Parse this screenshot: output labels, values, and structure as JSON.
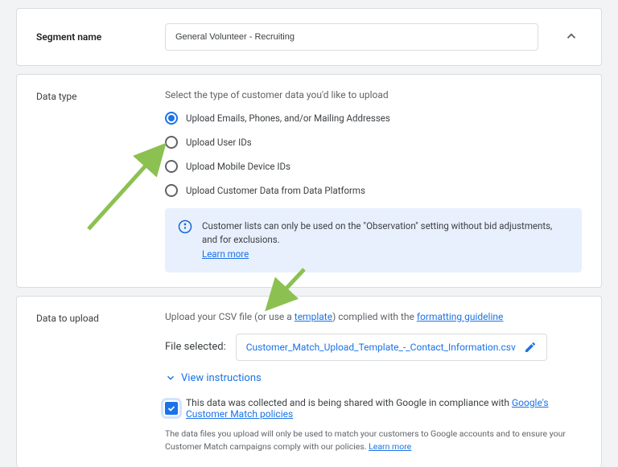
{
  "segment": {
    "label": "Segment name",
    "value": "General Volunteer - Recruiting"
  },
  "datatype": {
    "label": "Data type",
    "desc": "Select the type of customer data you'd like to upload",
    "options": [
      {
        "label": "Upload Emails, Phones, and/or Mailing Addresses",
        "selected": true
      },
      {
        "label": "Upload User IDs",
        "selected": false
      },
      {
        "label": "Upload Mobile Device IDs",
        "selected": false
      },
      {
        "label": "Upload Customer Data from Data Platforms",
        "selected": false
      }
    ],
    "info_text": "Customer lists can only be used on the \"Observation\" setting without bid adjustments, and for exclusions. ",
    "info_link": "Learn more"
  },
  "upload": {
    "label": "Data to upload",
    "desc_pre": "Upload your CSV file (or use a ",
    "desc_template": "template",
    "desc_mid": ") complied with the ",
    "desc_guideline": "formatting guideline",
    "file_label": "File selected:",
    "file_name": "Customer_Match_Upload_Template_-_Contact_Information.csv",
    "view_instructions": "View instructions",
    "compliance_text": "This data was collected and is being shared with Google in compliance with ",
    "compliance_link": "Google's Customer Match policies",
    "fine_print": "The data files you upload will only be used to match your customers to Google accounts and to ensure your Customer Match campaigns comply with our policies. ",
    "fine_print_link": "Learn more"
  }
}
